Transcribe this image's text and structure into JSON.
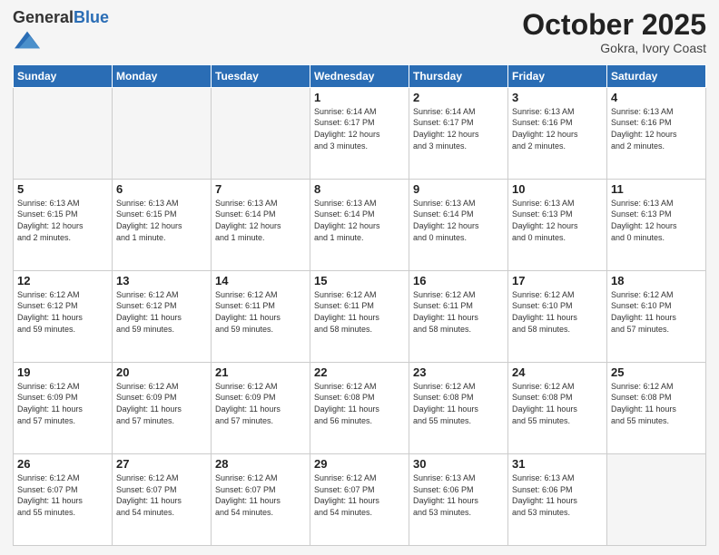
{
  "logo": {
    "general": "General",
    "blue": "Blue"
  },
  "header": {
    "month": "October 2025",
    "location": "Gokra, Ivory Coast"
  },
  "weekdays": [
    "Sunday",
    "Monday",
    "Tuesday",
    "Wednesday",
    "Thursday",
    "Friday",
    "Saturday"
  ],
  "weeks": [
    [
      {
        "day": "",
        "detail": ""
      },
      {
        "day": "",
        "detail": ""
      },
      {
        "day": "",
        "detail": ""
      },
      {
        "day": "1",
        "detail": "Sunrise: 6:14 AM\nSunset: 6:17 PM\nDaylight: 12 hours\nand 3 minutes."
      },
      {
        "day": "2",
        "detail": "Sunrise: 6:14 AM\nSunset: 6:17 PM\nDaylight: 12 hours\nand 3 minutes."
      },
      {
        "day": "3",
        "detail": "Sunrise: 6:13 AM\nSunset: 6:16 PM\nDaylight: 12 hours\nand 2 minutes."
      },
      {
        "day": "4",
        "detail": "Sunrise: 6:13 AM\nSunset: 6:16 PM\nDaylight: 12 hours\nand 2 minutes."
      }
    ],
    [
      {
        "day": "5",
        "detail": "Sunrise: 6:13 AM\nSunset: 6:15 PM\nDaylight: 12 hours\nand 2 minutes."
      },
      {
        "day": "6",
        "detail": "Sunrise: 6:13 AM\nSunset: 6:15 PM\nDaylight: 12 hours\nand 1 minute."
      },
      {
        "day": "7",
        "detail": "Sunrise: 6:13 AM\nSunset: 6:14 PM\nDaylight: 12 hours\nand 1 minute."
      },
      {
        "day": "8",
        "detail": "Sunrise: 6:13 AM\nSunset: 6:14 PM\nDaylight: 12 hours\nand 1 minute."
      },
      {
        "day": "9",
        "detail": "Sunrise: 6:13 AM\nSunset: 6:14 PM\nDaylight: 12 hours\nand 0 minutes."
      },
      {
        "day": "10",
        "detail": "Sunrise: 6:13 AM\nSunset: 6:13 PM\nDaylight: 12 hours\nand 0 minutes."
      },
      {
        "day": "11",
        "detail": "Sunrise: 6:13 AM\nSunset: 6:13 PM\nDaylight: 12 hours\nand 0 minutes."
      }
    ],
    [
      {
        "day": "12",
        "detail": "Sunrise: 6:12 AM\nSunset: 6:12 PM\nDaylight: 11 hours\nand 59 minutes."
      },
      {
        "day": "13",
        "detail": "Sunrise: 6:12 AM\nSunset: 6:12 PM\nDaylight: 11 hours\nand 59 minutes."
      },
      {
        "day": "14",
        "detail": "Sunrise: 6:12 AM\nSunset: 6:11 PM\nDaylight: 11 hours\nand 59 minutes."
      },
      {
        "day": "15",
        "detail": "Sunrise: 6:12 AM\nSunset: 6:11 PM\nDaylight: 11 hours\nand 58 minutes."
      },
      {
        "day": "16",
        "detail": "Sunrise: 6:12 AM\nSunset: 6:11 PM\nDaylight: 11 hours\nand 58 minutes."
      },
      {
        "day": "17",
        "detail": "Sunrise: 6:12 AM\nSunset: 6:10 PM\nDaylight: 11 hours\nand 58 minutes."
      },
      {
        "day": "18",
        "detail": "Sunrise: 6:12 AM\nSunset: 6:10 PM\nDaylight: 11 hours\nand 57 minutes."
      }
    ],
    [
      {
        "day": "19",
        "detail": "Sunrise: 6:12 AM\nSunset: 6:09 PM\nDaylight: 11 hours\nand 57 minutes."
      },
      {
        "day": "20",
        "detail": "Sunrise: 6:12 AM\nSunset: 6:09 PM\nDaylight: 11 hours\nand 57 minutes."
      },
      {
        "day": "21",
        "detail": "Sunrise: 6:12 AM\nSunset: 6:09 PM\nDaylight: 11 hours\nand 57 minutes."
      },
      {
        "day": "22",
        "detail": "Sunrise: 6:12 AM\nSunset: 6:08 PM\nDaylight: 11 hours\nand 56 minutes."
      },
      {
        "day": "23",
        "detail": "Sunrise: 6:12 AM\nSunset: 6:08 PM\nDaylight: 11 hours\nand 55 minutes."
      },
      {
        "day": "24",
        "detail": "Sunrise: 6:12 AM\nSunset: 6:08 PM\nDaylight: 11 hours\nand 55 minutes."
      },
      {
        "day": "25",
        "detail": "Sunrise: 6:12 AM\nSunset: 6:08 PM\nDaylight: 11 hours\nand 55 minutes."
      }
    ],
    [
      {
        "day": "26",
        "detail": "Sunrise: 6:12 AM\nSunset: 6:07 PM\nDaylight: 11 hours\nand 55 minutes."
      },
      {
        "day": "27",
        "detail": "Sunrise: 6:12 AM\nSunset: 6:07 PM\nDaylight: 11 hours\nand 54 minutes."
      },
      {
        "day": "28",
        "detail": "Sunrise: 6:12 AM\nSunset: 6:07 PM\nDaylight: 11 hours\nand 54 minutes."
      },
      {
        "day": "29",
        "detail": "Sunrise: 6:12 AM\nSunset: 6:07 PM\nDaylight: 11 hours\nand 54 minutes."
      },
      {
        "day": "30",
        "detail": "Sunrise: 6:13 AM\nSunset: 6:06 PM\nDaylight: 11 hours\nand 53 minutes."
      },
      {
        "day": "31",
        "detail": "Sunrise: 6:13 AM\nSunset: 6:06 PM\nDaylight: 11 hours\nand 53 minutes."
      },
      {
        "day": "",
        "detail": ""
      }
    ]
  ]
}
